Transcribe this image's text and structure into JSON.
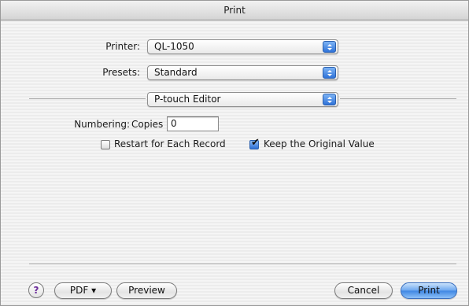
{
  "window": {
    "title": "Print"
  },
  "printer": {
    "label": "Printer:",
    "value": "QL-1050"
  },
  "presets": {
    "label": "Presets:",
    "value": "Standard"
  },
  "panel": {
    "value": "P-touch Editor"
  },
  "numbering": {
    "label": "Numbering:",
    "copies_label": "Copies",
    "copies_value": "0",
    "restart_label": "Restart for Each Record",
    "restart_checked": false,
    "keep_label": "Keep the Original Value",
    "keep_checked": true
  },
  "footer": {
    "help": "?",
    "pdf": "PDF ▾",
    "preview": "Preview",
    "cancel": "Cancel",
    "print": "Print"
  }
}
